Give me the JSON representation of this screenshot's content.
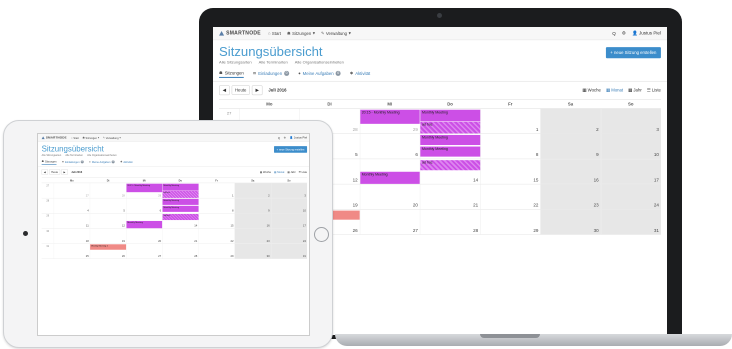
{
  "app": {
    "brand": "SMARTNODE",
    "nav": [
      {
        "label": "Start",
        "icon": "home-icon"
      },
      {
        "label": "Sitzungen",
        "icon": "users-icon",
        "caret": true
      },
      {
        "label": "Verwaltung",
        "icon": "wrench-icon",
        "caret": true
      }
    ],
    "nav_right": [
      "Q",
      "⚙",
      "Justus Piel"
    ],
    "title": "Sitzungsübersicht",
    "filters": [
      "Alle Sitzungsarten",
      "Alle Terminarten",
      "Alle Organisationseinheiten"
    ],
    "new_button": "+ neue Sitzung erstellen",
    "tabs": [
      {
        "label": "Sitzungen",
        "icon": "group-icon",
        "active": true
      },
      {
        "label": "Einladungen",
        "icon": "envelope-icon",
        "count": "0"
      },
      {
        "label": "Meine Aufgaben",
        "icon": "task-icon",
        "count": "0"
      },
      {
        "label": "Aktivität",
        "icon": "activity-icon"
      }
    ],
    "toolbar": {
      "today": "Heute",
      "month": "Juli 2016"
    },
    "views": [
      "Woche",
      "Monat",
      "Jahr",
      "Liste"
    ],
    "weekdays": [
      "Mo",
      "Di",
      "Mi",
      "Do",
      "Fr",
      "Sa",
      "So"
    ],
    "weeks": [
      {
        "no": "27",
        "days": [
          "27",
          "28",
          "29",
          "30",
          "1",
          "2",
          "3"
        ]
      },
      {
        "no": "28",
        "days": [
          "4",
          "5",
          "6",
          "7",
          "8",
          "9",
          "10"
        ]
      },
      {
        "no": "29",
        "days": [
          "11",
          "12",
          "13",
          "14",
          "15",
          "16",
          "17"
        ]
      },
      {
        "no": "30",
        "days": [
          "18",
          "19",
          "20",
          "21",
          "22",
          "23",
          "24"
        ]
      },
      {
        "no": "31",
        "days": [
          "25",
          "26",
          "27",
          "28",
          "29",
          "30",
          "31"
        ]
      }
    ],
    "events": [
      {
        "label": "20:15 - Monthly Meeting"
      },
      {
        "label": "Monthly Meeting"
      },
      {
        "label": "ad hoc"
      },
      {
        "label": "Monthly Meeting"
      },
      {
        "label": "Monthly Meeting"
      },
      {
        "label": "ad hoc"
      },
      {
        "label": "Monthly Meeting"
      },
      {
        "label": "Weekly Meeting 2"
      }
    ]
  },
  "colors": {
    "accent": "#3c8dcb",
    "event": "#cc4fe6",
    "weekend": "#e7e7e7",
    "event_alt": "#f08a86"
  }
}
